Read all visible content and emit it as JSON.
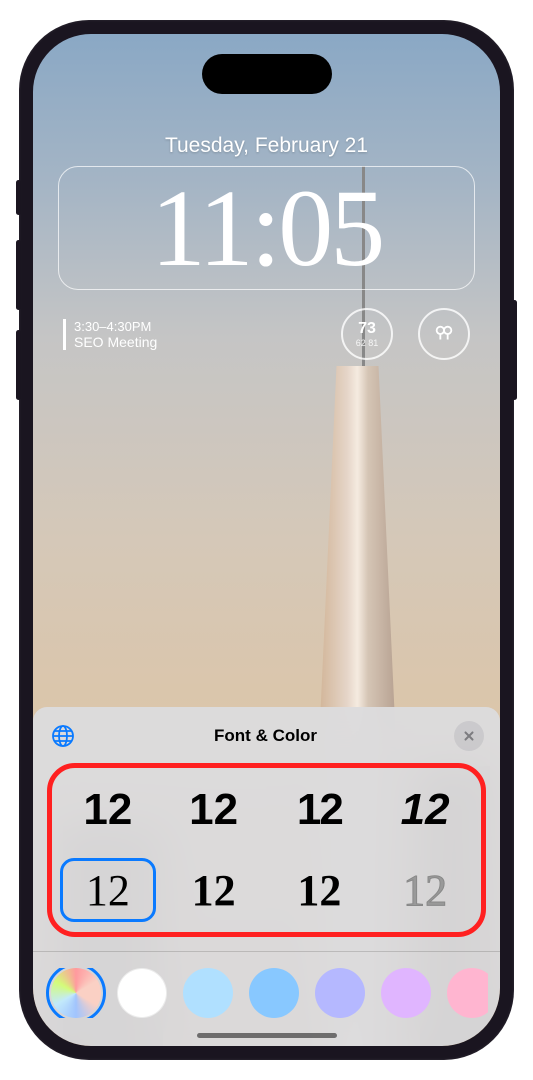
{
  "lockscreen": {
    "date": "Tuesday, February 21",
    "time": "11:05",
    "calendar": {
      "time_range": "3:30–4:30PM",
      "title": "SEO Meeting"
    },
    "weather": {
      "temp": "73",
      "low": "62",
      "high": "81"
    }
  },
  "panel": {
    "title": "Font & Color",
    "font_sample": "12",
    "fonts": [
      {
        "id": "f1",
        "selected": false
      },
      {
        "id": "f2",
        "selected": false
      },
      {
        "id": "f3",
        "selected": false
      },
      {
        "id": "f4",
        "selected": false
      },
      {
        "id": "f5",
        "selected": true
      },
      {
        "id": "f6",
        "selected": false
      },
      {
        "id": "f7",
        "selected": false
      },
      {
        "id": "f8",
        "selected": false
      }
    ],
    "colors": [
      {
        "name": "gradient",
        "css": "conic-gradient(#ff9a9e, #fad0c4, #fad0c4, #a1c4fd, #c2e9fb, #d4fc79, #ff9a9e)",
        "selected": true
      },
      {
        "name": "white",
        "css": "#ffffff",
        "selected": false
      },
      {
        "name": "light-blue",
        "css": "#b0e0ff",
        "selected": false
      },
      {
        "name": "blue",
        "css": "#88c8ff",
        "selected": false
      },
      {
        "name": "periwinkle",
        "css": "#b5b8ff",
        "selected": false
      },
      {
        "name": "lavender",
        "css": "#e0b5ff",
        "selected": false
      },
      {
        "name": "pink",
        "css": "#ffb5d0",
        "selected": false
      }
    ]
  }
}
